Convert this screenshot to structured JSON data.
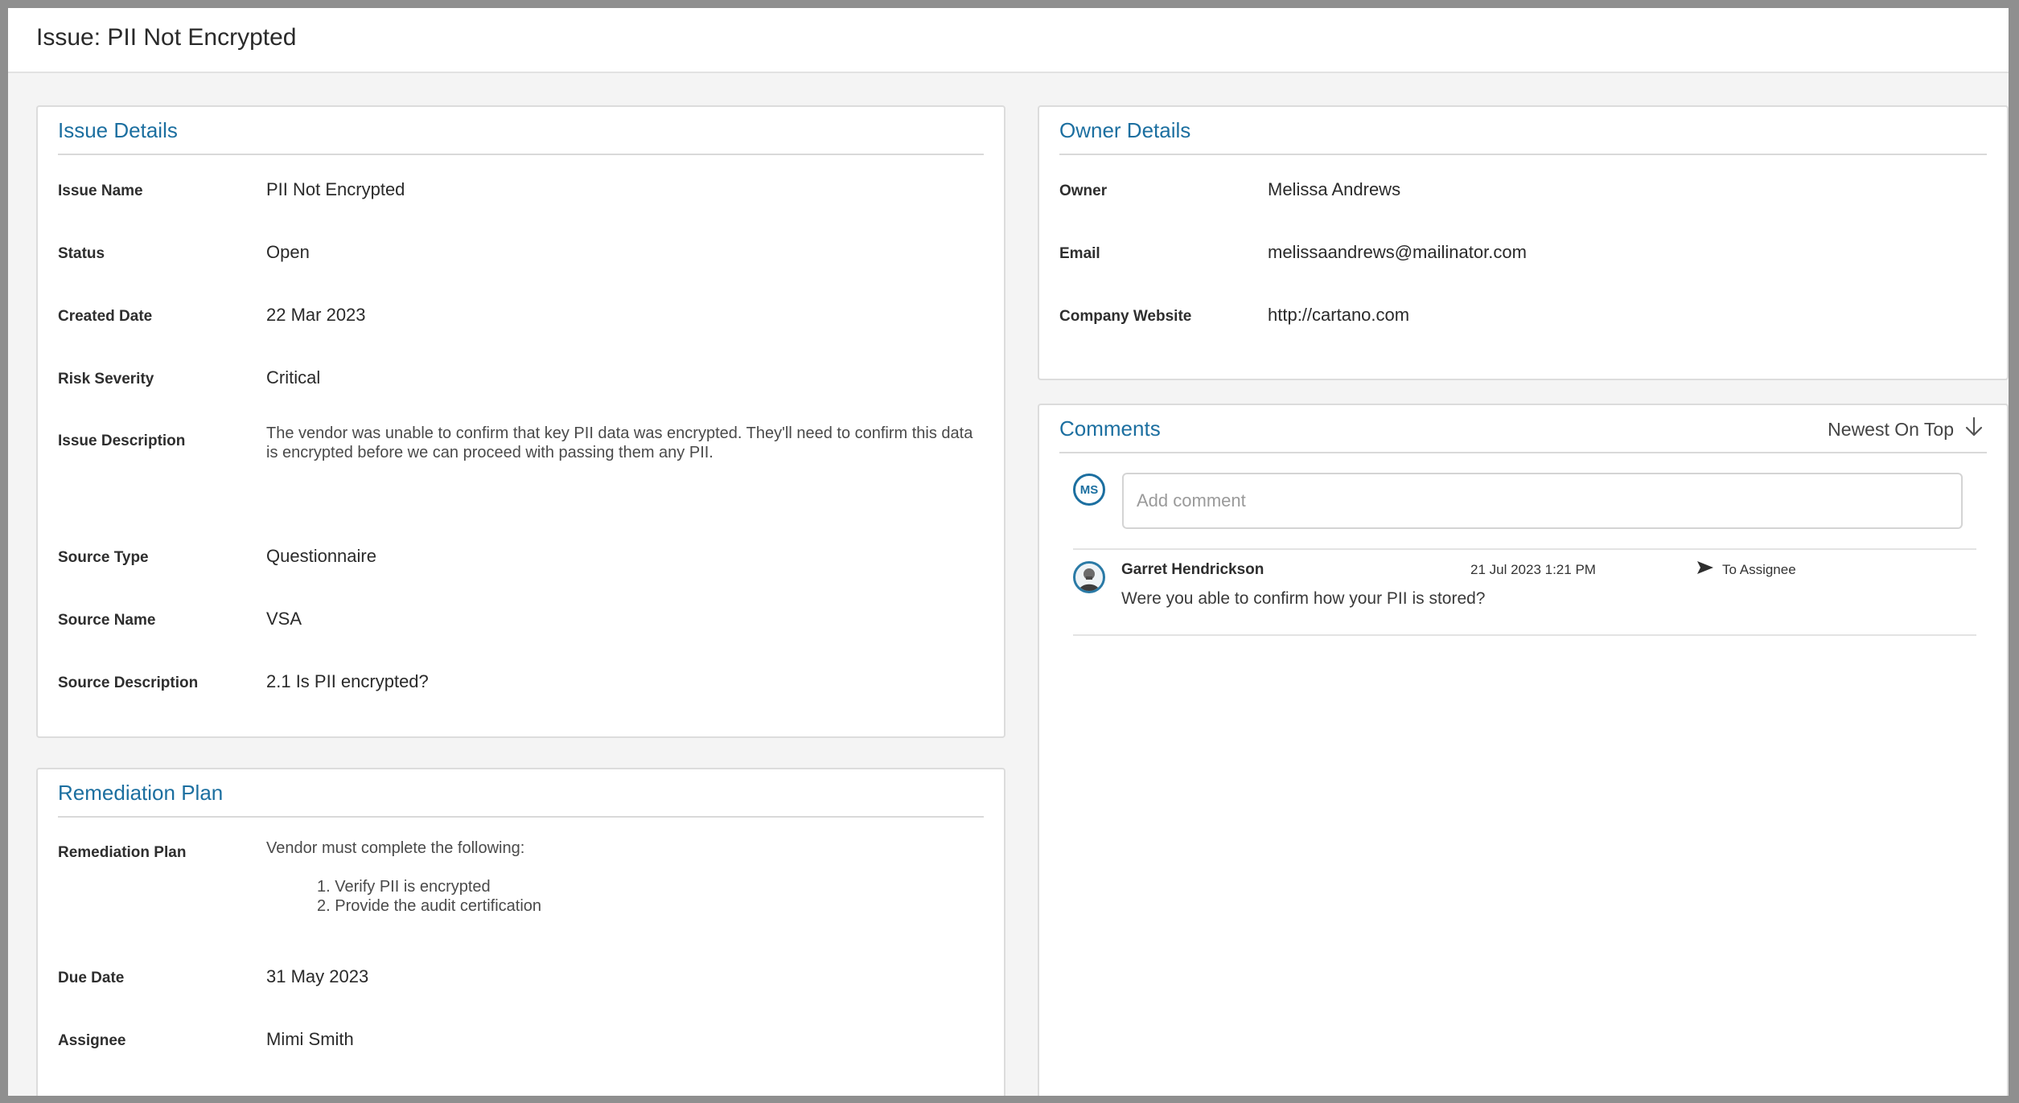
{
  "page": {
    "title": "Issue: PII Not Encrypted"
  },
  "issue_details": {
    "title": "Issue Details",
    "fields": [
      {
        "label": "Issue Name",
        "value": "PII Not Encrypted"
      },
      {
        "label": "Status",
        "value": "Open"
      },
      {
        "label": "Created Date",
        "value": "22 Mar 2023"
      },
      {
        "label": "Risk Severity",
        "value": "Critical"
      },
      {
        "label": "Issue Description",
        "value": "The vendor was unable to confirm that key PII data was encrypted. They'll need to confirm this data is encrypted before we can proceed with passing them any PII."
      },
      {
        "label": "Source Type",
        "value": "Questionnaire"
      },
      {
        "label": "Source Name",
        "value": "VSA"
      },
      {
        "label": "Source Description",
        "value": "2.1 Is PII encrypted?"
      }
    ]
  },
  "remediation": {
    "title": "Remediation Plan",
    "plan_label": "Remediation Plan",
    "plan_intro": "Vendor must complete the following:",
    "plan_items": [
      "1. Verify PII is encrypted",
      "2. Provide the audit certification"
    ],
    "due_label": "Due Date",
    "due_value": "31 May 2023",
    "assignee_label": "Assignee",
    "assignee_value": "Mimi Smith"
  },
  "owner_details": {
    "title": "Owner Details",
    "fields": [
      {
        "label": "Owner",
        "value": "Melissa Andrews"
      },
      {
        "label": "Email",
        "value": "melissaandrews@mailinator.com"
      },
      {
        "label": "Company Website",
        "value": "http://cartano.com"
      }
    ]
  },
  "comments": {
    "title": "Comments",
    "sort_label": "Newest On Top",
    "current_user_initials": "MS",
    "input_placeholder": "Add comment",
    "items": [
      {
        "author": "Garret Hendrickson",
        "timestamp": "21 Jul 2023 1:21 PM",
        "recipient": "To Assignee",
        "text": "Were you able to confirm how your PII is stored?"
      }
    ]
  },
  "colors": {
    "accent": "#1c6fa0",
    "background": "#f4f4f4",
    "card": "#ffffff"
  },
  "icons": {
    "sort": "arrow-down-icon",
    "send": "send-icon",
    "avatar": "user-avatar-icon"
  }
}
